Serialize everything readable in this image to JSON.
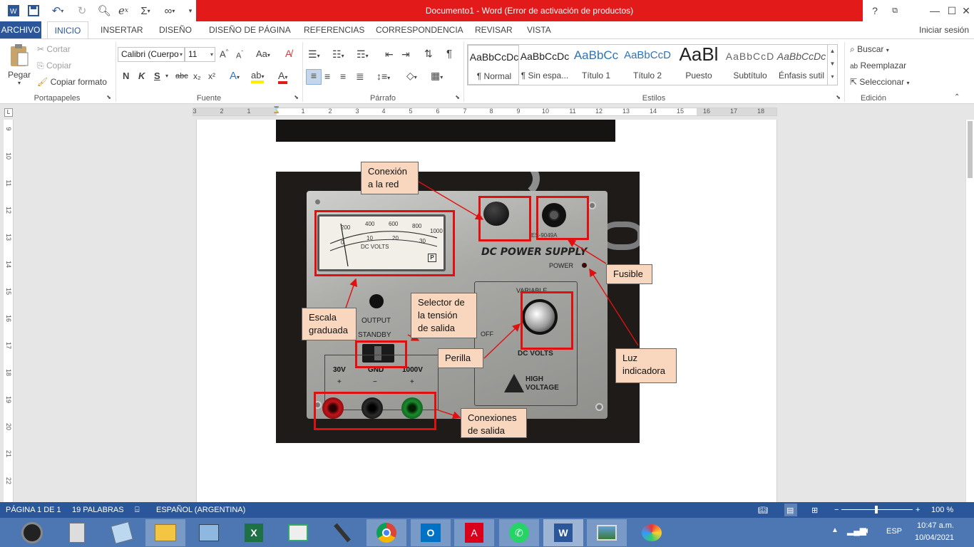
{
  "titlebar": {
    "title": "Documento1 -  Word (Error de activación de productos)",
    "help": "?",
    "signin": "Iniciar sesión"
  },
  "tabs": [
    "ARCHIVO",
    "INICIO",
    "INSERTAR",
    "DISEÑO",
    "DISEÑO DE PÁGINA",
    "REFERENCIAS",
    "CORRESPONDENCIA",
    "REVISAR",
    "VISTA"
  ],
  "clipboard": {
    "paste": "Pegar",
    "cut": "Cortar",
    "copy": "Copiar",
    "format_painter": "Copiar formato",
    "label": "Portapapeles"
  },
  "font": {
    "name": "Calibri (Cuerpo",
    "size": "11",
    "label": "Fuente",
    "bold": "N",
    "italic": "K",
    "underline": "S",
    "strike": "abc",
    "sub": "x₂",
    "sup": "x²"
  },
  "paragraph": {
    "label": "Párrafo"
  },
  "styles": {
    "label": "Estilos",
    "items": [
      {
        "preview": "AaBbCcDc",
        "name": "¶ Normal"
      },
      {
        "preview": "AaBbCcDc",
        "name": "¶ Sin espa..."
      },
      {
        "preview": "AaBbCc",
        "name": "Título 1"
      },
      {
        "preview": "AaBbCcD",
        "name": "Título 2"
      },
      {
        "preview": "AaBl",
        "name": "Puesto"
      },
      {
        "preview": "AaBbCcD",
        "name": "Subtítulo"
      },
      {
        "preview": "AaBbCcDc",
        "name": "Énfasis sutil"
      }
    ]
  },
  "editing": {
    "find": "Buscar",
    "replace": "Reemplazar",
    "select": "Seleccionar",
    "label": "Edición"
  },
  "ruler": {
    "numbers": [
      "3",
      "2",
      "1",
      "1",
      "2",
      "3",
      "4",
      "5",
      "6",
      "7",
      "8",
      "9",
      "10",
      "11",
      "12",
      "13",
      "14",
      "15",
      "16",
      "17",
      "18"
    ],
    "vnumbers": [
      "9",
      "10",
      "11",
      "12",
      "13",
      "14",
      "15",
      "16",
      "17",
      "18",
      "19",
      "20",
      "21",
      "22"
    ]
  },
  "figure": {
    "meter_scale_top": [
      "200",
      "400",
      "600",
      "800",
      "1000"
    ],
    "meter_scale_bottom": [
      "0",
      "10",
      "20",
      "30"
    ],
    "meter_unit": "DC VOLTS",
    "brand": "DC POWER SUPPLY",
    "model": "ES-9049A",
    "power": "POWER",
    "output": "OUTPUT",
    "standby": "STANDBY",
    "variable": "VARIABLE",
    "off": "OFF",
    "dcvolts": "DC VOLTS",
    "high_voltage": "HIGH VOLTAGE",
    "terminals": [
      "30V",
      "GND",
      "1000V"
    ],
    "signs": [
      "+",
      "−",
      "+"
    ],
    "callouts": {
      "red": "Conexión a la red",
      "fusible": "Fusible",
      "escala": "Escala graduada",
      "selector": "Selector de la tensión de salida",
      "perilla": "Perilla",
      "luz": "Luz indicadora",
      "salida": "Conexiones de salida"
    }
  },
  "status": {
    "page": "PÁGINA 1 DE 1",
    "words": "19 PALABRAS",
    "language": "ESPAÑOL (ARGENTINA)",
    "zoom": "100 %"
  },
  "taskbar": {
    "lang": "ESP",
    "time": "10:47 a.m.",
    "date": "10/04/2021"
  }
}
